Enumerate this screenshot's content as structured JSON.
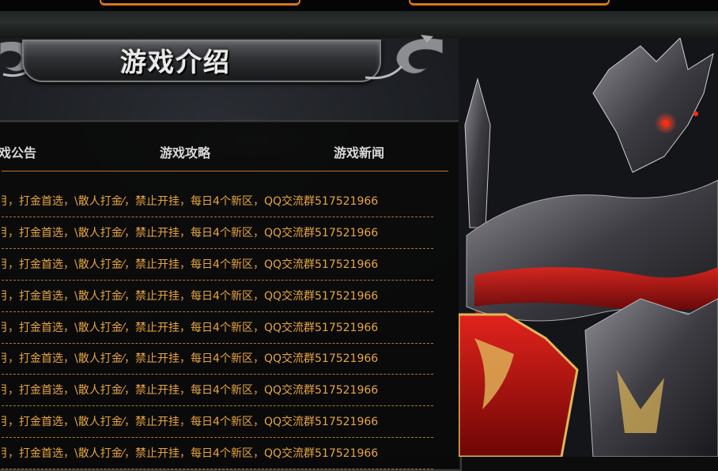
{
  "header": {
    "title": "游戏介绍"
  },
  "news": {
    "tabs": [
      {
        "label": "戏公告"
      },
      {
        "label": "游戏攻略"
      },
      {
        "label": "游戏新闻"
      }
    ],
    "items": [
      {
        "text": "月，打金首选，\\散人打金⁄，禁止开挂，每日4个新区，QQ交流群517521966"
      },
      {
        "text": "月，打金首选，\\散人打金⁄，禁止开挂，每日4个新区，QQ交流群517521966"
      },
      {
        "text": "月，打金首选，\\散人打金⁄，禁止开挂，每日4个新区，QQ交流群517521966"
      },
      {
        "text": "月，打金首选，\\散人打金⁄，禁止开挂，每日4个新区，QQ交流群517521966"
      },
      {
        "text": "月，打金首选，\\散人打金⁄，禁止开挂，每日4个新区，QQ交流群517521966"
      },
      {
        "text": "月，打金首选，\\散人打金⁄，禁止开挂，每日4个新区，QQ交流群517521966"
      },
      {
        "text": "月，打金首选，\\散人打金⁄，禁止开挂，每日4个新区，QQ交流群517521966"
      },
      {
        "text": "月，打金首选，\\散人打金⁄，禁止开挂，每日4个新区，QQ交流群517521966"
      },
      {
        "text": "月，打金首选，\\散人打金⁄，禁止开挂，每日4个新区，QQ交流群517521966"
      }
    ]
  },
  "colors": {
    "accent_orange": "#d9761a",
    "news_text": "#e8a640",
    "divider": "#b07a2a"
  },
  "decor": {
    "warrior_image": "armored-red-warrior-illustration",
    "ornaments": "silver-scroll-ornament-icon"
  }
}
